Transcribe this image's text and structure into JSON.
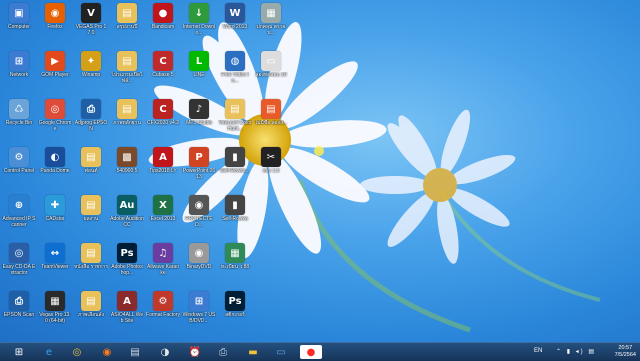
{
  "desktop": {
    "icons": [
      {
        "label": "Computer",
        "glyph": "▣",
        "color": "#3b7bd1",
        "col": 0,
        "row": 0
      },
      {
        "label": "Firefox",
        "glyph": "◉",
        "color": "#e66000",
        "col": 1,
        "row": 0
      },
      {
        "label": "VEGAS Pro 17.0",
        "glyph": "V",
        "color": "#222",
        "col": 2,
        "row": 0
      },
      {
        "label": "สรุปงานปี",
        "glyph": "▤",
        "color": "#e8c15a",
        "col": 3,
        "row": 0
      },
      {
        "label": "Bandicam",
        "glyph": "●",
        "color": "#c0151b",
        "col": 4,
        "row": 0
      },
      {
        "label": "Internet Downlo...",
        "glyph": "↓",
        "color": "#2e9a3b",
        "col": 5,
        "row": 0
      },
      {
        "label": "Word 2013",
        "glyph": "W",
        "color": "#2b579a",
        "col": 6,
        "row": 0
      },
      {
        "label": "ปกคลุม ตรวจบ...",
        "glyph": "▦",
        "color": "#9aa",
        "col": 7,
        "row": 0
      },
      {
        "label": "Network",
        "glyph": "⊞",
        "color": "#3b7bd1",
        "col": 0,
        "row": 1
      },
      {
        "label": "GOM Player",
        "glyph": "▶",
        "color": "#e24a1b",
        "col": 1,
        "row": 1
      },
      {
        "label": "Winamp",
        "glyph": "✦",
        "color": "#d4a017",
        "col": 2,
        "row": 1
      },
      {
        "label": "โปรแกรมเปิดไฟล์...",
        "glyph": "▤",
        "color": "#e8c15a",
        "col": 3,
        "row": 1
      },
      {
        "label": "Cubase 5",
        "glyph": "C",
        "color": "#c02a2a",
        "col": 4,
        "row": 1
      },
      {
        "label": "LINE",
        "glyph": "L",
        "color": "#00b900",
        "col": 5,
        "row": 1
      },
      {
        "label": "Free Video to...",
        "glyph": "◍",
        "color": "#2a6fc2",
        "col": 6,
        "row": 1
      },
      {
        "label": "ลองทดสอบ 10",
        "glyph": "▭",
        "color": "#ddd",
        "col": 7,
        "row": 1
      },
      {
        "label": "Recycle Bin",
        "glyph": "♺",
        "color": "#6aa4d8",
        "col": 0,
        "row": 2
      },
      {
        "label": "Google Chrome",
        "glyph": "◎",
        "color": "#dd4b39",
        "col": 1,
        "row": 2
      },
      {
        "label": "Adjprog EPSON",
        "glyph": "⎙",
        "color": "#1e5fa8",
        "col": 2,
        "row": 2
      },
      {
        "label": "ภาพหลักฐาน",
        "glyph": "▤",
        "color": "#e8c15a",
        "col": 3,
        "row": 2
      },
      {
        "label": "CFX2020 v4.2",
        "glyph": "C",
        "color": "#b22",
        "col": 4,
        "row": 2
      },
      {
        "label": "MP3 Studio",
        "glyph": "♪",
        "color": "#333",
        "col": 5,
        "row": 2
      },
      {
        "label": "โฟลเดอร์ Color Hunt...",
        "glyph": "▤",
        "color": "#e8c15a",
        "col": 6,
        "row": 2
      },
      {
        "label": "ไม่มีชื่อ ลองสิ...",
        "glyph": "▤",
        "color": "#e85a2a",
        "col": 7,
        "row": 2
      },
      {
        "label": "Control Panel",
        "glyph": "⚙",
        "color": "#4a8ed6",
        "col": 0,
        "row": 3
      },
      {
        "label": "Panda Dome",
        "glyph": "◐",
        "color": "#1a4e9a",
        "col": 1,
        "row": 3
      },
      {
        "label": "ฟอนต์",
        "glyph": "▤",
        "color": "#e8c15a",
        "col": 2,
        "row": 3
      },
      {
        "label": "540900 5",
        "glyph": "▩",
        "color": "#7a4a2a",
        "col": 3,
        "row": 3
      },
      {
        "label": "Tips2018 LY",
        "glyph": "A",
        "color": "#c0151b",
        "col": 4,
        "row": 3
      },
      {
        "label": "PowerPoint 2013",
        "glyph": "P",
        "color": "#d04423",
        "col": 5,
        "row": 3
      },
      {
        "label": "Self-Rowka...",
        "glyph": "▮",
        "color": "#444",
        "col": 6,
        "row": 3
      },
      {
        "label": "ลอง 1.5",
        "glyph": "✂",
        "color": "#222",
        "col": 7,
        "row": 3
      },
      {
        "label": "Advanced IP Scanner",
        "glyph": "⊕",
        "color": "#2a7fd0",
        "col": 0,
        "row": 4
      },
      {
        "label": "CADstar",
        "glyph": "✚",
        "color": "#2a9ad8",
        "col": 1,
        "row": 4
      },
      {
        "label": "ผลงาน",
        "glyph": "▤",
        "color": "#e8c15a",
        "col": 2,
        "row": 4
      },
      {
        "label": "Adobe Audition CC",
        "glyph": "Au",
        "color": "#0a5e63",
        "col": 3,
        "row": 4
      },
      {
        "label": "Excel 2013",
        "glyph": "X",
        "color": "#1e7145",
        "col": 4,
        "row": 4
      },
      {
        "label": "PROTECTED...",
        "glyph": "◉",
        "color": "#555",
        "col": 5,
        "row": 4
      },
      {
        "label": "Self-Rowka",
        "glyph": "▮",
        "color": "#444",
        "col": 6,
        "row": 4
      },
      {
        "label": "Easy CD-DA Extractor",
        "glyph": "◎",
        "color": "#2a5fa8",
        "col": 0,
        "row": 5
      },
      {
        "label": "TeamViewer",
        "glyph": "↔",
        "color": "#0e6fd0",
        "col": 1,
        "row": 5
      },
      {
        "label": "หนังสือ ราชการ",
        "glyph": "▤",
        "color": "#e8c15a",
        "col": 2,
        "row": 5
      },
      {
        "label": "Adobe Photoshop...",
        "glyph": "Ps",
        "color": "#001e36",
        "col": 3,
        "row": 5
      },
      {
        "label": "Allwave Karaoke",
        "glyph": "♫",
        "color": "#6a3ea1",
        "col": 4,
        "row": 5
      },
      {
        "label": "BinaryDVD",
        "glyph": "◉",
        "color": "#999",
        "col": 5,
        "row": 5
      },
      {
        "label": "ทะเบียน ว 88",
        "glyph": "▦",
        "color": "#2e8b57",
        "col": 6,
        "row": 5
      },
      {
        "label": "EPSON Scan",
        "glyph": "⎙",
        "color": "#1e5fa8",
        "col": 0,
        "row": 6
      },
      {
        "label": "Vegas Pro 13.0 (64-bit)",
        "glyph": "▦",
        "color": "#2a2a2a",
        "col": 1,
        "row": 6
      },
      {
        "label": "ภาพเลือนลั่ง",
        "glyph": "▤",
        "color": "#e8c15a",
        "col": 2,
        "row": 6
      },
      {
        "label": "ASIO4ALL Web Site",
        "glyph": "A",
        "color": "#8a2a2a",
        "col": 3,
        "row": 6
      },
      {
        "label": "Format Factory",
        "glyph": "⚙",
        "color": "#c0392b",
        "col": 4,
        "row": 6
      },
      {
        "label": "Windows 7 USB/DVD...",
        "glyph": "⊞",
        "color": "#3b7bd1",
        "col": 5,
        "row": 6
      },
      {
        "label": "สติกเกอร์",
        "glyph": "Ps",
        "color": "#001e36",
        "col": 6,
        "row": 6
      }
    ]
  },
  "taskbar": {
    "items": [
      {
        "name": "start-button",
        "glyph": "⊞",
        "color": "#ffffff"
      },
      {
        "name": "ie-taskbar-icon",
        "glyph": "e",
        "color": "#3aa0f0"
      },
      {
        "name": "chrome-taskbar-icon",
        "glyph": "◎",
        "color": "#f3c03a"
      },
      {
        "name": "firefox-taskbar-icon",
        "glyph": "◉",
        "color": "#ff7a1a"
      },
      {
        "name": "files-taskbar-icon",
        "glyph": "▤",
        "color": "#cfd8e6"
      },
      {
        "name": "media-taskbar-icon",
        "glyph": "◑",
        "color": "#e6e6e6"
      },
      {
        "name": "alarm-taskbar-icon",
        "glyph": "⏰",
        "color": "#ff5a3a"
      },
      {
        "name": "scanner-taskbar-icon",
        "glyph": "⎙",
        "color": "#cfd8e6"
      },
      {
        "name": "explorer-taskbar-icon",
        "glyph": "▬",
        "color": "#f3c03a"
      },
      {
        "name": "display-taskbar-icon",
        "glyph": "▭",
        "color": "#5aa0e8"
      },
      {
        "name": "bandicam-taskbar-icon",
        "glyph": "●",
        "color": "#ff2a2a"
      }
    ],
    "language": "EN",
    "time": "20:57",
    "date": "7/5/2564"
  }
}
